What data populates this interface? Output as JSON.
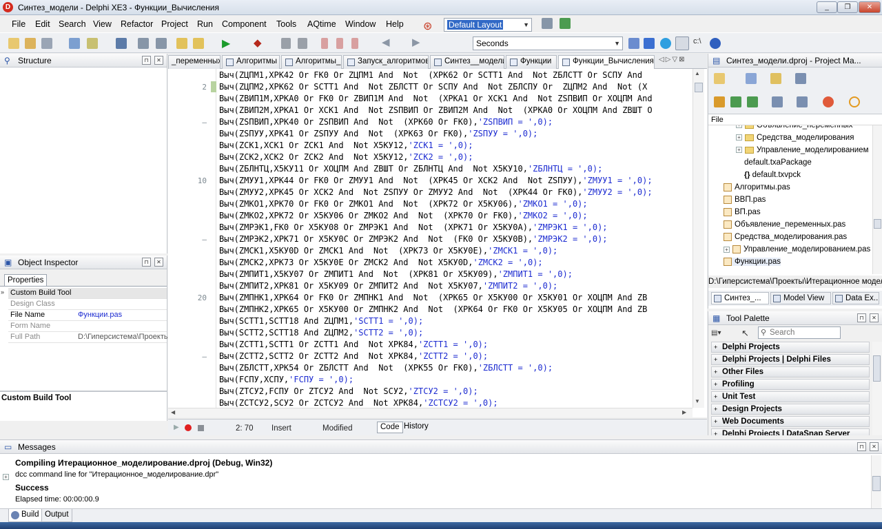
{
  "window": {
    "title": "Синтез_модели - Delphi XE3 - Функции_Вычисления"
  },
  "menu": [
    "File",
    "Edit",
    "Search",
    "View",
    "Refactor",
    "Project",
    "Run",
    "Component",
    "Tools",
    "AQtime",
    "Window",
    "Help"
  ],
  "toolbar": {
    "layout_value": "Default Layout",
    "units_value": "Seconds"
  },
  "structure": {
    "title": "Structure"
  },
  "object_inspector": {
    "title": "Object Inspector",
    "tab": "Properties",
    "rows": [
      {
        "key": "Custom Build Tool",
        "value": ""
      },
      {
        "key": "Design Class",
        "value": ""
      },
      {
        "key": "File Name",
        "value": "Функции.pas"
      },
      {
        "key": "Form Name",
        "value": ""
      },
      {
        "key": "Full Path",
        "value": "D:\\Гиперсистема\\Проекты"
      }
    ],
    "footer_title": "Custom Build Tool"
  },
  "editor_tabs": [
    "_переменных",
    "Алгоритмы",
    "Алгоритмы_",
    "Запуск_алгоритмов",
    "Синтез__модели",
    "Функции",
    "Функции_Вычисления"
  ],
  "code_lines": [
    {
      "n": "",
      "code": "Выч(ZЦПМ1,XPK42 Or FK0 Or ZЦПМ1 And  Not  (XPK62 Or SCTT1 And  Not ZБЛСТТ Or SCПУ And ",
      "str": ""
    },
    {
      "n": "2",
      "code": "Выч(ZЦПМ2,XPK62 Or SCTT1 And  Not ZБЛСТТ Or SCПУ And  Not ZБЛСПУ Or  ZЦПМ2 And  Not (X",
      "str": ""
    },
    {
      "n": "",
      "code": "Выч(ZBИП1M,XPKA0 Or FK0 Or ZBИП1M And  Not  (XPKA1 Or XCK1 And  Not ZSПВИП Or XOЦПМ And",
      "str": ""
    },
    {
      "n": "",
      "code": "Выч(ZBИП2M,XPKA1 Or XCK1 And  Not ZSПВИП Or ZBИП2M And  Not  (XPKA0 Or XOЦПМ And ZBШТ O",
      "str": ""
    },
    {
      "n": "–",
      "code": "Выч(ZSПВИП,XPK40 Or ZSПВИП And  Not  (XPK60 Or FK0),",
      "str": "'ZSПВИП = ',0);"
    },
    {
      "n": "",
      "code": "Выч(ZSПУУ,XPK41 Or ZSПУУ And  Not  (XPK63 Or FK0),",
      "str": "'ZSПУУ = ',0);"
    },
    {
      "n": "",
      "code": "Выч(ZCK1,XCK1 Or ZCK1 And  Not X5KУ12,",
      "str": "'ZCK1 = ',0);"
    },
    {
      "n": "",
      "code": "Выч(ZCK2,XCK2 Or ZCK2 And  Not X5KУ12,",
      "str": "'ZCK2 = ',0);"
    },
    {
      "n": "",
      "code": "Выч(ZБЛНТЦ,X5KУ11 Or XOЦПМ And ZBШТ Or ZБЛНТЦ And  Not X5KУ10,",
      "str": "'ZБЛНТЦ = ',0);"
    },
    {
      "n": "10",
      "code": "Выч(ZMУУ1,XPK44 Or FK0 Or ZMУУ1 And  Not  (XPK45 Or XCK2 And  Not ZSПУУ),",
      "str": "'ZMУУ1 = ',0);"
    },
    {
      "n": "",
      "code": "Выч(ZMУУ2,XPK45 Or XCK2 And  Not ZSПУУ Or ZMУУ2 And  Not  (XPK44 Or FK0),",
      "str": "'ZMУУ2 = ',0);"
    },
    {
      "n": "",
      "code": "Выч(ZMKO1,XPK70 Or FK0 Or ZMKO1 And  Not  (XPK72 Or X5KУ06),",
      "str": "'ZMKO1 = ',0);"
    },
    {
      "n": "",
      "code": "Выч(ZMKO2,XPK72 Or X5KУ06 Or ZMKO2 And  Not  (XPK70 Or FK0),",
      "str": "'ZMKO2 = ',0);"
    },
    {
      "n": "",
      "code": "Выч(ZMPЭK1,FK0 Or X5KУ08 Or ZMPЭK1 And  Not  (XPK71 Or X5KУ0A),",
      "str": "'ZMPЭK1 = ',0);"
    },
    {
      "n": "–",
      "code": "Выч(ZMPЭK2,XPK71 Or X5KУ0C Or ZMPЭK2 And  Not  (FK0 Or X5KУ0B),",
      "str": "'ZMPЭK2 = ',0);"
    },
    {
      "n": "",
      "code": "Выч(ZMCK1,X5KУ0D Or ZMCK1 And  Not  (XPK73 Or X5KУ0E),",
      "str": "'ZMCK1 = ',0);"
    },
    {
      "n": "",
      "code": "Выч(ZMCK2,XPK73 Or X5KУ0E Or ZMCK2 And  Not X5KУ0D,",
      "str": "'ZMCK2 = ',0);"
    },
    {
      "n": "",
      "code": "Выч(ZMПИТ1,X5KУ07 Or ZMПИТ1 And  Not  (XPK81 Or X5KУ09),",
      "str": "'ZMПИТ1 = ',0);"
    },
    {
      "n": "",
      "code": "Выч(ZMПИТ2,XPK81 Or X5KУ09 Or ZMПИТ2 And  Not X5KУ07,",
      "str": "'ZMПИТ2 = ',0);"
    },
    {
      "n": "20",
      "code": "Выч(ZMПHK1,XPK64 Or FK0 Or ZMПHK1 And  Not  (XPK65 Or X5KУ00 Or X5KУ01 Or XOЦПМ And ZB",
      "str": ""
    },
    {
      "n": "",
      "code": "Выч(ZMПHK2,XPK65 Or X5KУ00 Or ZMПHK2 And  Not  (XPK64 Or FK0 Or X5KУ05 Or XOЦПМ And ZB",
      "str": ""
    },
    {
      "n": "",
      "code": "Выч(SCTT1,SCTT18 And ZЦПМ1,",
      "str": "'SCTT1 = ',0);"
    },
    {
      "n": "",
      "code": "Выч(SCTT2,SCTT18 And ZЦПМ2,",
      "str": "'SCTT2 = ',0);"
    },
    {
      "n": "",
      "code": "Выч(ZCTT1,SCTT1 Or ZCTT1 And  Not XPK84,",
      "str": "'ZCTT1 = ',0);"
    },
    {
      "n": "–",
      "code": "Выч(ZCTT2,SCTT2 Or ZCTT2 And  Not XPK84,",
      "str": "'ZCTT2 = ',0);"
    },
    {
      "n": "",
      "code": "Выч(ZБЛСТТ,XPK54 Or ZБЛСТТ And  Not  (XPK55 Or FK0),",
      "str": "'ZБЛСТТ = ',0);"
    },
    {
      "n": "",
      "code": "Выч(FCПУ,XCПУ,",
      "str": "'FCПУ = ',0);"
    },
    {
      "n": "",
      "code": "Выч(ZTCУ2,FCПУ Or ZTCУ2 And  Not SCУ2,",
      "str": "'ZTCУ2 = ',0);"
    },
    {
      "n": "",
      "code": "Выч(ZCTCУ2,SCУ2 Or ZCTCУ2 And  Not XPK84,",
      "str": "'ZCTCУ2 = ',0);"
    }
  ],
  "status": {
    "position": "2: 70",
    "mode": "Insert",
    "state": "Modified",
    "tab_code": "Code",
    "tab_history": "History"
  },
  "project_manager": {
    "title": "Синтез_модели.dproj - Project Ma...",
    "filter_label": "File",
    "items": [
      {
        "label": "Объявление_переменных",
        "type": "folder",
        "indent": 2
      },
      {
        "label": "Средства_моделирования",
        "type": "folder",
        "indent": 2
      },
      {
        "label": "Управление_моделированием",
        "type": "folder",
        "indent": 2
      },
      {
        "label": "default.txaPackage",
        "type": "none",
        "indent": 3
      },
      {
        "label": "default.txvpck",
        "type": "brace",
        "indent": 3
      },
      {
        "label": "Алгоритмы.pas",
        "type": "pas",
        "indent": 1
      },
      {
        "label": "ВВП.pas",
        "type": "pas",
        "indent": 1
      },
      {
        "label": "ВП.pas",
        "type": "pas",
        "indent": 1
      },
      {
        "label": "Объявление_переменных.pas",
        "type": "pas",
        "indent": 1
      },
      {
        "label": "Средства_моделирования.pas",
        "type": "pas",
        "indent": 1
      },
      {
        "label": "Управление_моделированием.pas",
        "type": "pas",
        "indent": 1
      },
      {
        "label": "Функции.pas",
        "type": "pas",
        "indent": 1
      }
    ],
    "path": "D:\\Гиперсистема\\Проекты\\Итерационное моделир",
    "tabs": [
      "Синтез_...",
      "Model View",
      "Data Ex..."
    ]
  },
  "tool_palette": {
    "title": "Tool Palette",
    "search_placeholder": "Search",
    "categories": [
      "Delphi Projects",
      "Delphi Projects | Delphi Files",
      "Other Files",
      "Profiling",
      "Unit Test",
      "Design Projects",
      "Web Documents",
      "Delphi Projects | DataSnap Server"
    ]
  },
  "messages": {
    "title": "Messages",
    "lines": [
      {
        "text": "Compiling Итерационное_моделирование.dproj (Debug, Win32)",
        "bold": true
      },
      {
        "text": "dcc command line for \"Итерационное_моделирование.dpr\"",
        "bold": false
      },
      {
        "text": "Success",
        "bold": true
      },
      {
        "text": "Elapsed time: 00:00:00.9",
        "bold": false
      }
    ],
    "tabs": [
      "Build",
      "Output"
    ]
  }
}
